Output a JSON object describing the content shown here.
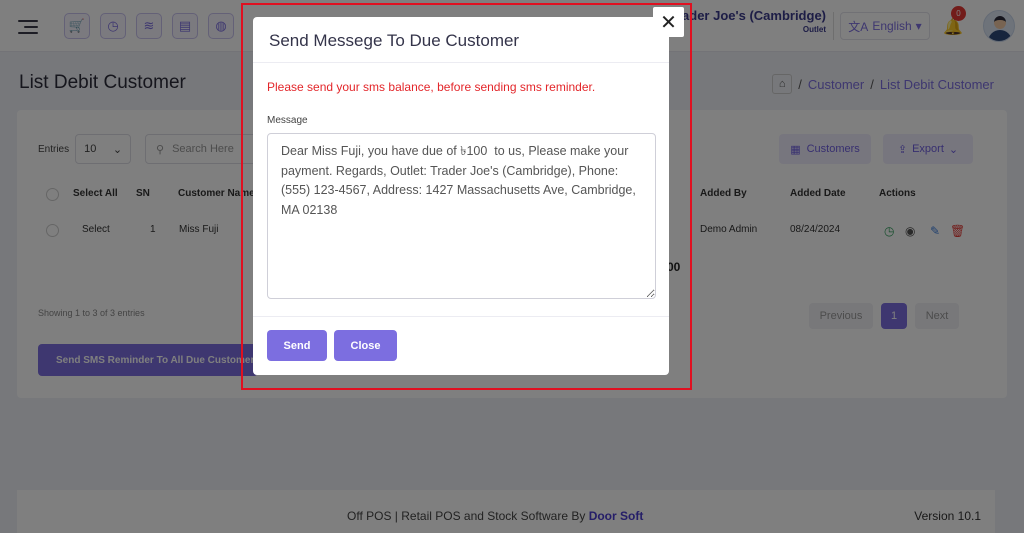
{
  "topbar": {
    "outlet_name": "Trader Joe's (Cambridge)",
    "outlet_sub": "Outlet",
    "language": "English",
    "notification_count": "0",
    "icons": [
      "cart-icon",
      "clock-icon",
      "layers-icon",
      "register-icon",
      "globe-icon"
    ]
  },
  "page": {
    "title": "List Debit Customer",
    "breadcrumb": [
      "Customer",
      "List Debit Customer"
    ]
  },
  "toolbar": {
    "entries_label": "Entries",
    "entries_value": "10",
    "search_placeholder": "Search Here",
    "customers_label": "Customers",
    "export_label": "Export"
  },
  "table": {
    "headers": [
      "Select All",
      "SN",
      "Customer Name",
      "Added By",
      "Added Date",
      "Actions"
    ],
    "rows": [
      {
        "select": "Select",
        "sn": "1",
        "name": "Miss Fuji",
        "added_by": "Demo Admin",
        "added_date": "08/24/2024"
      }
    ],
    "total_fragment": "00"
  },
  "pagination": {
    "showing": "Showing 1 to 3 of 3 entries",
    "previous": "Previous",
    "current": "1",
    "next": "Next"
  },
  "sms_all_button": "Send SMS Reminder To All Due Customer",
  "footer": {
    "text": "Off POS | Retail POS and Stock Software By",
    "brand": "Door Soft",
    "version": "Version 10.1"
  },
  "modal": {
    "title": "Send Messege To Due Customer",
    "warning": "Please send your sms balance, before sending sms reminder.",
    "message_label": "Message",
    "message_value": "Dear Miss Fuji, you have due of ৳100  to us, Please make your payment. Regards, Outlet: Trader Joe's (Cambridge), Phone: (555) 123-4567, Address: 1427 Massachusetts Ave, Cambridge, MA 02138",
    "send_label": "Send",
    "close_label": "Close"
  },
  "colors": {
    "accent": "#7c6ee0",
    "warning": "#e3262a",
    "highlight": "#e01020"
  }
}
